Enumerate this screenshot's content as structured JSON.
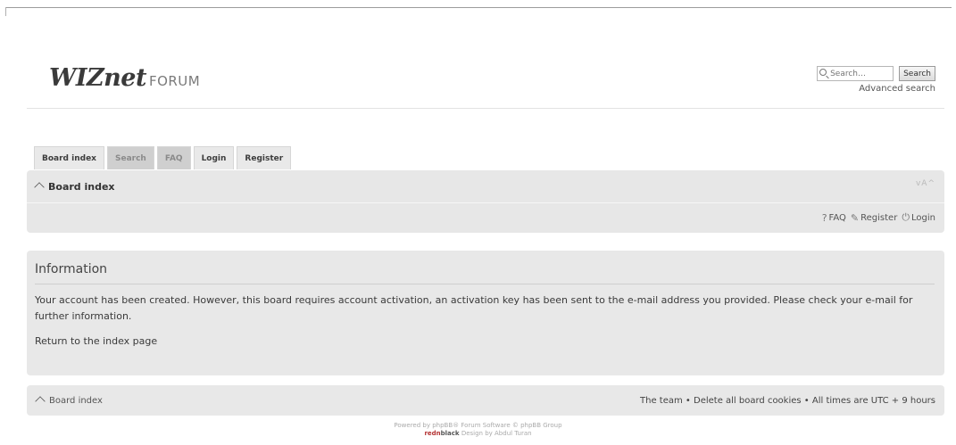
{
  "header": {
    "logo_main": "WIZnet",
    "logo_sub": "FORUM",
    "search_placeholder": "Search…",
    "search_button": "Search",
    "advanced_search": "Advanced search"
  },
  "tabs": [
    {
      "label": "Board index",
      "active": true
    },
    {
      "label": "Search",
      "active": false
    },
    {
      "label": "FAQ",
      "active": false
    },
    {
      "label": "Login",
      "active": true
    },
    {
      "label": "Register",
      "active": true
    }
  ],
  "navbar": {
    "breadcrumb": "Board index",
    "fontsize": "vA^",
    "links": {
      "faq": "FAQ",
      "register": "Register",
      "login": "Login"
    }
  },
  "panel": {
    "title": "Information",
    "message": "Your account has been created. However, this board requires account activation, an activation key has been sent to the e-mail address you provided. Please check your e-mail for further information.",
    "return_link": "Return to the index page"
  },
  "footer": {
    "board_index": "Board index",
    "right_text": "The team • Delete all board cookies • All times are UTC + 9 hours"
  },
  "copyright": {
    "line1": "Powered by phpBB® Forum Software © phpBB Group",
    "brand_red": "redn",
    "brand_dark": "black",
    "line2_rest": " Design by Abdul Turan"
  }
}
